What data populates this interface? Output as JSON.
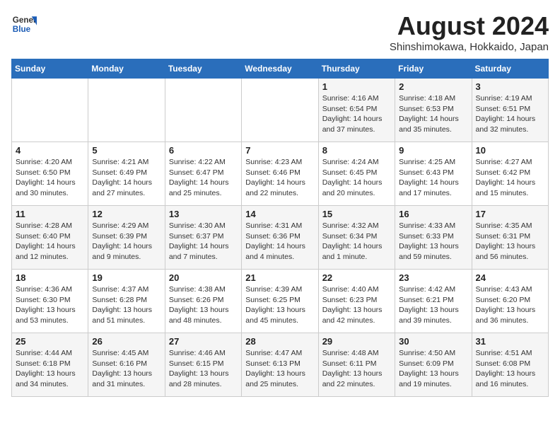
{
  "header": {
    "logo_line1": "General",
    "logo_line2": "Blue",
    "title": "August 2024",
    "subtitle": "Shinshimokawa, Hokkaido, Japan"
  },
  "days_of_week": [
    "Sunday",
    "Monday",
    "Tuesday",
    "Wednesday",
    "Thursday",
    "Friday",
    "Saturday"
  ],
  "weeks": [
    [
      {
        "num": "",
        "info": ""
      },
      {
        "num": "",
        "info": ""
      },
      {
        "num": "",
        "info": ""
      },
      {
        "num": "",
        "info": ""
      },
      {
        "num": "1",
        "info": "Sunrise: 4:16 AM\nSunset: 6:54 PM\nDaylight: 14 hours\nand 37 minutes."
      },
      {
        "num": "2",
        "info": "Sunrise: 4:18 AM\nSunset: 6:53 PM\nDaylight: 14 hours\nand 35 minutes."
      },
      {
        "num": "3",
        "info": "Sunrise: 4:19 AM\nSunset: 6:51 PM\nDaylight: 14 hours\nand 32 minutes."
      }
    ],
    [
      {
        "num": "4",
        "info": "Sunrise: 4:20 AM\nSunset: 6:50 PM\nDaylight: 14 hours\nand 30 minutes."
      },
      {
        "num": "5",
        "info": "Sunrise: 4:21 AM\nSunset: 6:49 PM\nDaylight: 14 hours\nand 27 minutes."
      },
      {
        "num": "6",
        "info": "Sunrise: 4:22 AM\nSunset: 6:47 PM\nDaylight: 14 hours\nand 25 minutes."
      },
      {
        "num": "7",
        "info": "Sunrise: 4:23 AM\nSunset: 6:46 PM\nDaylight: 14 hours\nand 22 minutes."
      },
      {
        "num": "8",
        "info": "Sunrise: 4:24 AM\nSunset: 6:45 PM\nDaylight: 14 hours\nand 20 minutes."
      },
      {
        "num": "9",
        "info": "Sunrise: 4:25 AM\nSunset: 6:43 PM\nDaylight: 14 hours\nand 17 minutes."
      },
      {
        "num": "10",
        "info": "Sunrise: 4:27 AM\nSunset: 6:42 PM\nDaylight: 14 hours\nand 15 minutes."
      }
    ],
    [
      {
        "num": "11",
        "info": "Sunrise: 4:28 AM\nSunset: 6:40 PM\nDaylight: 14 hours\nand 12 minutes."
      },
      {
        "num": "12",
        "info": "Sunrise: 4:29 AM\nSunset: 6:39 PM\nDaylight: 14 hours\nand 9 minutes."
      },
      {
        "num": "13",
        "info": "Sunrise: 4:30 AM\nSunset: 6:37 PM\nDaylight: 14 hours\nand 7 minutes."
      },
      {
        "num": "14",
        "info": "Sunrise: 4:31 AM\nSunset: 6:36 PM\nDaylight: 14 hours\nand 4 minutes."
      },
      {
        "num": "15",
        "info": "Sunrise: 4:32 AM\nSunset: 6:34 PM\nDaylight: 14 hours\nand 1 minute."
      },
      {
        "num": "16",
        "info": "Sunrise: 4:33 AM\nSunset: 6:33 PM\nDaylight: 13 hours\nand 59 minutes."
      },
      {
        "num": "17",
        "info": "Sunrise: 4:35 AM\nSunset: 6:31 PM\nDaylight: 13 hours\nand 56 minutes."
      }
    ],
    [
      {
        "num": "18",
        "info": "Sunrise: 4:36 AM\nSunset: 6:30 PM\nDaylight: 13 hours\nand 53 minutes."
      },
      {
        "num": "19",
        "info": "Sunrise: 4:37 AM\nSunset: 6:28 PM\nDaylight: 13 hours\nand 51 minutes."
      },
      {
        "num": "20",
        "info": "Sunrise: 4:38 AM\nSunset: 6:26 PM\nDaylight: 13 hours\nand 48 minutes."
      },
      {
        "num": "21",
        "info": "Sunrise: 4:39 AM\nSunset: 6:25 PM\nDaylight: 13 hours\nand 45 minutes."
      },
      {
        "num": "22",
        "info": "Sunrise: 4:40 AM\nSunset: 6:23 PM\nDaylight: 13 hours\nand 42 minutes."
      },
      {
        "num": "23",
        "info": "Sunrise: 4:42 AM\nSunset: 6:21 PM\nDaylight: 13 hours\nand 39 minutes."
      },
      {
        "num": "24",
        "info": "Sunrise: 4:43 AM\nSunset: 6:20 PM\nDaylight: 13 hours\nand 36 minutes."
      }
    ],
    [
      {
        "num": "25",
        "info": "Sunrise: 4:44 AM\nSunset: 6:18 PM\nDaylight: 13 hours\nand 34 minutes."
      },
      {
        "num": "26",
        "info": "Sunrise: 4:45 AM\nSunset: 6:16 PM\nDaylight: 13 hours\nand 31 minutes."
      },
      {
        "num": "27",
        "info": "Sunrise: 4:46 AM\nSunset: 6:15 PM\nDaylight: 13 hours\nand 28 minutes."
      },
      {
        "num": "28",
        "info": "Sunrise: 4:47 AM\nSunset: 6:13 PM\nDaylight: 13 hours\nand 25 minutes."
      },
      {
        "num": "29",
        "info": "Sunrise: 4:48 AM\nSunset: 6:11 PM\nDaylight: 13 hours\nand 22 minutes."
      },
      {
        "num": "30",
        "info": "Sunrise: 4:50 AM\nSunset: 6:09 PM\nDaylight: 13 hours\nand 19 minutes."
      },
      {
        "num": "31",
        "info": "Sunrise: 4:51 AM\nSunset: 6:08 PM\nDaylight: 13 hours\nand 16 minutes."
      }
    ]
  ]
}
